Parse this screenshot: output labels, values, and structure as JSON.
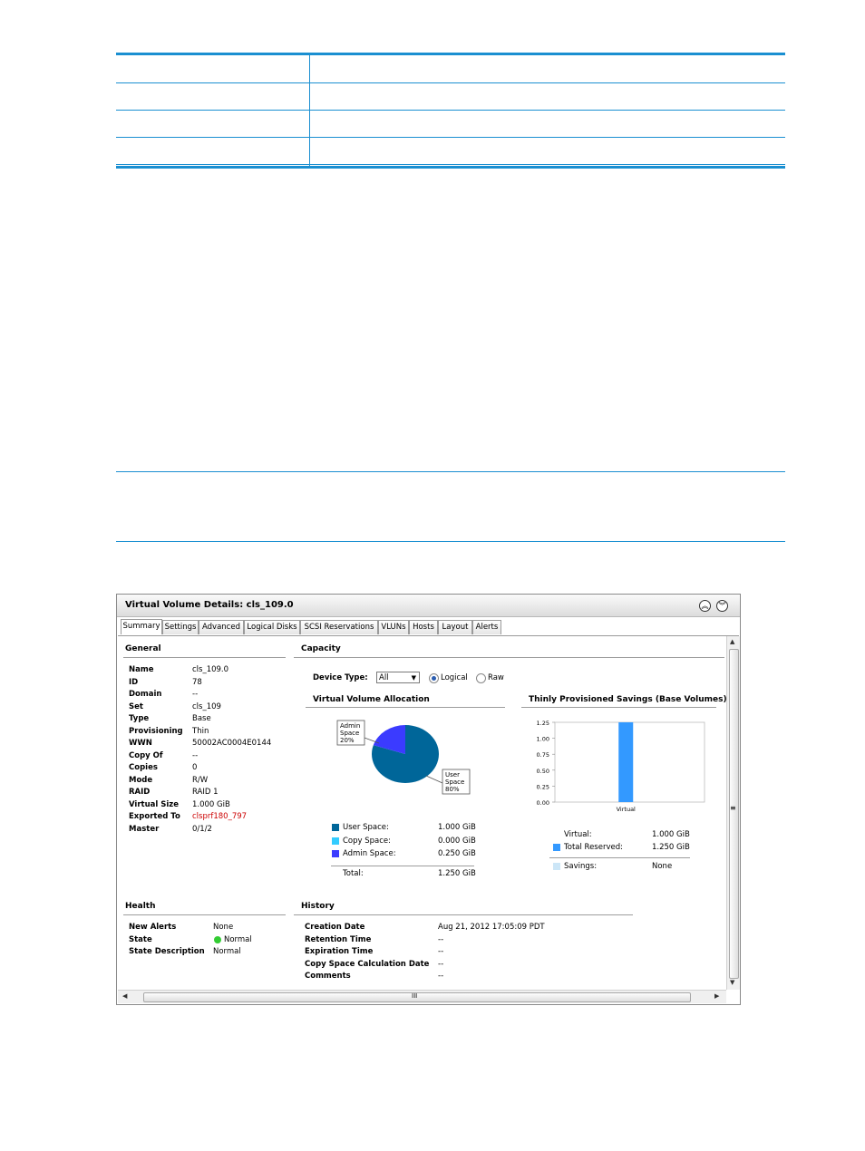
{
  "window": {
    "title": "Virtual Volume Details: cls_109.0",
    "tabs": [
      "Summary",
      "Settings",
      "Advanced",
      "Logical Disks",
      "SCSI Reservations",
      "VLUNs",
      "Hosts",
      "Layout",
      "Alerts"
    ],
    "active_tab": "Summary"
  },
  "general": {
    "title": "General",
    "rows": [
      {
        "label": "Name",
        "value": "cls_109.0"
      },
      {
        "label": "ID",
        "value": "78"
      },
      {
        "label": "Domain",
        "value": "--"
      },
      {
        "label": "Set",
        "value": "cls_109"
      },
      {
        "label": "Type",
        "value": "Base"
      },
      {
        "label": "Provisioning",
        "value": "Thin"
      },
      {
        "label": "WWN",
        "value": "50002AC0004E0144"
      },
      {
        "label": "Copy Of",
        "value": "--"
      },
      {
        "label": "Copies",
        "value": "0"
      },
      {
        "label": "Mode",
        "value": "R/W"
      },
      {
        "label": "RAID",
        "value": "RAID 1"
      },
      {
        "label": "Virtual Size",
        "value": "1.000 GiB"
      },
      {
        "label": "Exported To",
        "value": "clsprf180_797"
      },
      {
        "label": "Master",
        "value": "0/1/2"
      }
    ],
    "link_color": "#cc0000"
  },
  "capacity": {
    "title": "Capacity",
    "device_type_label": "Device Type:",
    "device_type_value": "All",
    "radio_logical": "Logical",
    "radio_raw": "Raw",
    "allocation_title": "Virtual Volume Allocation",
    "pie_labels": {
      "admin": [
        "Admin",
        "Space",
        "20%"
      ],
      "user": [
        "User",
        "Space",
        "80%"
      ]
    },
    "legend": [
      {
        "name": "User Space:",
        "value": "1.000 GiB",
        "color": "#006699"
      },
      {
        "name": "Copy Space:",
        "value": "0.000 GiB",
        "color": "#33ccff"
      },
      {
        "name": "Admin Space:",
        "value": "0.250 GiB",
        "color": "#3b3bff"
      }
    ],
    "total_label": "Total:",
    "total_value": "1.250 GiB",
    "savings_title": "Thinly Provisioned Savings (Base Volumes)",
    "savings_rows": [
      {
        "name": "Virtual:",
        "value": "1.000 GiB"
      },
      {
        "name": "Total Reserved:",
        "value": "1.250 GiB",
        "color": "#3399ff"
      },
      {
        "name": "Savings:",
        "value": "None",
        "color": "#cce6f7"
      }
    ]
  },
  "chart_data": [
    {
      "type": "pie",
      "title": "Virtual Volume Allocation",
      "slices": [
        {
          "name": "User Space",
          "value": 80,
          "color": "#006699"
        },
        {
          "name": "Admin Space",
          "value": 20,
          "color": "#3b3bff"
        }
      ]
    },
    {
      "type": "bar",
      "title": "Thinly Provisioned Savings (Base Volumes)",
      "categories": [
        "Virtual"
      ],
      "values": [
        1.25
      ],
      "ylim": [
        0,
        1.25
      ],
      "yticks": [
        "1.25",
        "1.00",
        "0.75",
        "0.50",
        "0.25",
        "0.00"
      ],
      "color": "#3399ff"
    }
  ],
  "health": {
    "title": "Health",
    "rows": [
      {
        "label": "New Alerts",
        "value": "None"
      },
      {
        "label": "State",
        "value": "Normal"
      },
      {
        "label": "State Description",
        "value": "Normal"
      }
    ],
    "state_color": "#33cc33"
  },
  "history": {
    "title": "History",
    "rows": [
      {
        "label": "Creation Date",
        "value": "Aug 21, 2012 17:05:09 PDT"
      },
      {
        "label": "Retention Time",
        "value": "--"
      },
      {
        "label": "Expiration Time",
        "value": "--"
      },
      {
        "label": "Copy Space Calculation Date",
        "value": "--"
      },
      {
        "label": "Comments",
        "value": "--"
      }
    ]
  },
  "scroll": {
    "grip": "≡",
    "hgrip": "III"
  }
}
